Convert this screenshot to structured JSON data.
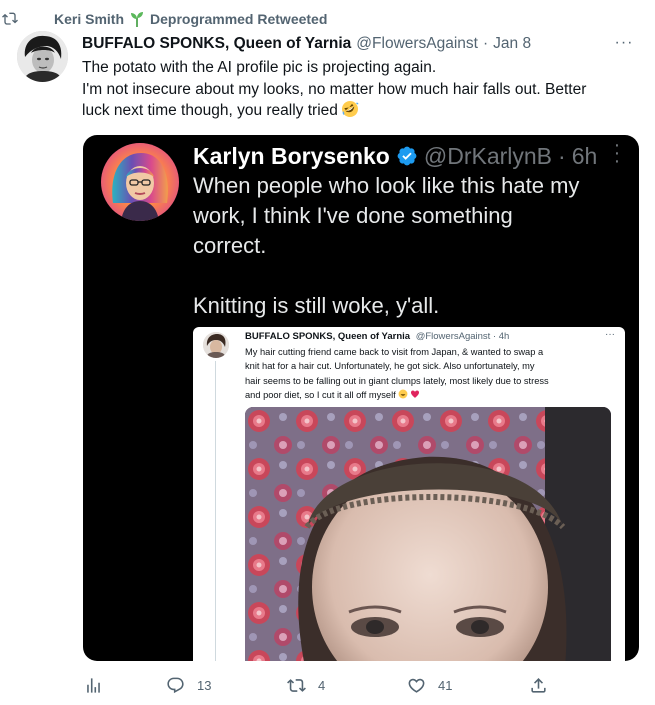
{
  "retweet_context": {
    "user": "Keri Smith",
    "label": "Deprogrammed Retweeted"
  },
  "tweet": {
    "author_name": "BUFFALO SPONKS, Queen of Yarnia",
    "handle": "@FlowersAgainst",
    "separator": "·",
    "date": "Jan 8",
    "more_label": "···",
    "text_lines": [
      "The potato with the AI profile pic is projecting again.",
      "I'm not insecure about my looks, no matter how much hair falls out. Better",
      "luck next time though, you really tried"
    ],
    "text_emoji": "rolling-on-floor-laughing-emoji"
  },
  "media": {
    "quoted": {
      "author_name": "Karlyn Borysenko",
      "handle": "@DrKarlynB",
      "separator": "·",
      "time": "6h",
      "verified_icon": "verified-badge-icon",
      "text_lines": [
        "When people who look like this hate my",
        "work, I think I've done something",
        "correct.",
        "",
        "Knitting is still woke, y'all."
      ]
    },
    "screenshot": {
      "author_name": "BUFFALO SPONKS, Queen of Yarnia",
      "handle": "@FlowersAgainst · 4h",
      "more_label": "···",
      "text_lines": [
        "My hair cutting friend came back to visit from Japan, & wanted to swap a",
        "knit hat for a hair cut. Unfortunately, he got sick. Also unfortunately, my",
        "hair seems to be falling out in giant clumps lately, most likely due to stress",
        "and poor diet, so I cut it all off myself"
      ]
    }
  },
  "actions": {
    "analytics_icon": "analytics-icon",
    "reply_count": "13",
    "retweet_count": "4",
    "like_count": "41",
    "share_icon": "share-icon"
  },
  "colors": {
    "text": "#0f1419",
    "secondary": "#536471",
    "retweet_green": "#00ba7c",
    "verified_blue": "#1d9bf0",
    "media_bg": "#000000"
  }
}
